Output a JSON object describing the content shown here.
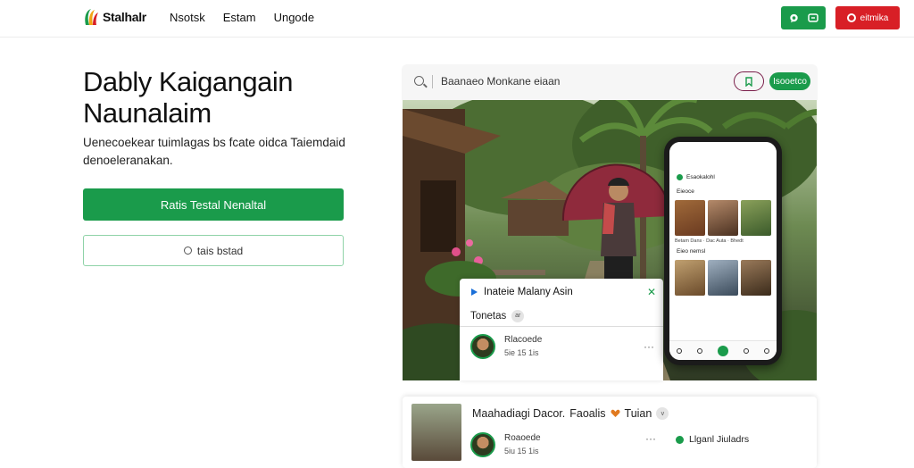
{
  "brand": {
    "name": "Stalhalr"
  },
  "nav": {
    "links": [
      "Nsotsk",
      "Estam",
      "Ungode"
    ],
    "red_button_label": "eitmika"
  },
  "hero": {
    "title_line1": "Dably Kaigangain",
    "title_line2": "Naunalaim",
    "subtitle_line1": "Uenecoekear tuimlagas bs fcate oidca Taiemdaid",
    "subtitle_line2": "denoeleranakan.",
    "primary_cta": "Ratis Testal Nenaltal",
    "secondary_cta": "tais bstad"
  },
  "search": {
    "placeholder": "Baanaeo Monkane eiaan",
    "go_label": "Isooetco"
  },
  "chat": {
    "title": "Inateie Malany Asin",
    "tab_label": "Tonetas",
    "tab_chip": "ar",
    "row_name": "Rlacoede",
    "row_meta": "5ie 15 1is"
  },
  "phone": {
    "header": "Esaokalohl",
    "section1": "Eieoce",
    "section2": "Eieo nemsl",
    "tags": [
      "Betam Dans",
      "Dac Auta",
      "Bhedt"
    ]
  },
  "bottom_card": {
    "title": "Maahadiagi Dacor.",
    "title_tag": "Faoalis",
    "title_tail": "Tuian",
    "title_chip": "v",
    "row_name": "Roaoede",
    "row_meta": "5iu 15 1is",
    "status": "Llganl Jiuladrs"
  },
  "colors": {
    "green": "#1a9b4b",
    "red": "#d81f26"
  }
}
